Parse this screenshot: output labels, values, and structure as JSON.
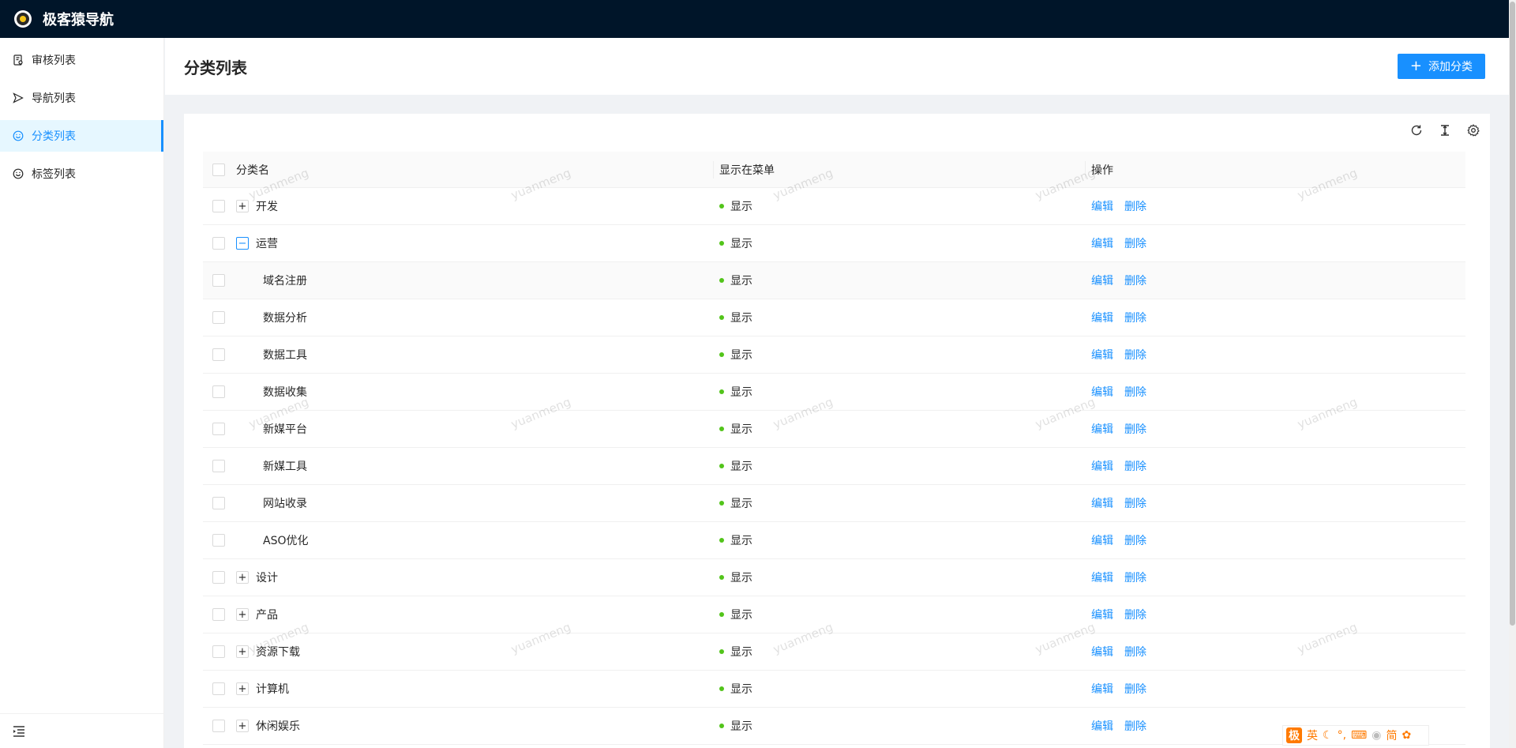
{
  "app": {
    "title": "极客猿导航"
  },
  "sidebar": {
    "items": [
      {
        "label": "审核列表",
        "icon": "audit-icon",
        "active": false
      },
      {
        "label": "导航列表",
        "icon": "send-icon",
        "active": false
      },
      {
        "label": "分类列表",
        "icon": "smile-icon",
        "active": true
      },
      {
        "label": "标签列表",
        "icon": "smile-icon",
        "active": false
      }
    ]
  },
  "header": {
    "title": "分类列表",
    "add_button": "添加分类"
  },
  "table": {
    "columns": [
      "分类名",
      "显示在菜单",
      "操作"
    ],
    "rows": [
      {
        "name": "开发",
        "level": 0,
        "expand": "collapsed",
        "show": "显示"
      },
      {
        "name": "运营",
        "level": 0,
        "expand": "expanded",
        "show": "显示"
      },
      {
        "name": "域名注册",
        "level": 1,
        "expand": "none",
        "show": "显示"
      },
      {
        "name": "数据分析",
        "level": 1,
        "expand": "none",
        "show": "显示"
      },
      {
        "name": "数据工具",
        "level": 1,
        "expand": "none",
        "show": "显示"
      },
      {
        "name": "数据收集",
        "level": 1,
        "expand": "none",
        "show": "显示"
      },
      {
        "name": "新媒平台",
        "level": 1,
        "expand": "none",
        "show": "显示"
      },
      {
        "name": "新媒工具",
        "level": 1,
        "expand": "none",
        "show": "显示"
      },
      {
        "name": "网站收录",
        "level": 1,
        "expand": "none",
        "show": "显示"
      },
      {
        "name": "ASO优化",
        "level": 1,
        "expand": "none",
        "show": "显示"
      },
      {
        "name": "设计",
        "level": 0,
        "expand": "collapsed",
        "show": "显示"
      },
      {
        "name": "产品",
        "level": 0,
        "expand": "collapsed",
        "show": "显示"
      },
      {
        "name": "资源下载",
        "level": 0,
        "expand": "collapsed",
        "show": "显示"
      },
      {
        "name": "计算机",
        "level": 0,
        "expand": "collapsed",
        "show": "显示"
      },
      {
        "name": "休闲娱乐",
        "level": 0,
        "expand": "collapsed",
        "show": "显示"
      }
    ],
    "edit_label": "编辑",
    "delete_label": "删除"
  },
  "watermark": "yuanmeng",
  "ime": {
    "labels": [
      "英",
      "简"
    ]
  },
  "colors": {
    "primary": "#1890ff",
    "topbar": "#001529",
    "status_dot": "#52c41a"
  }
}
